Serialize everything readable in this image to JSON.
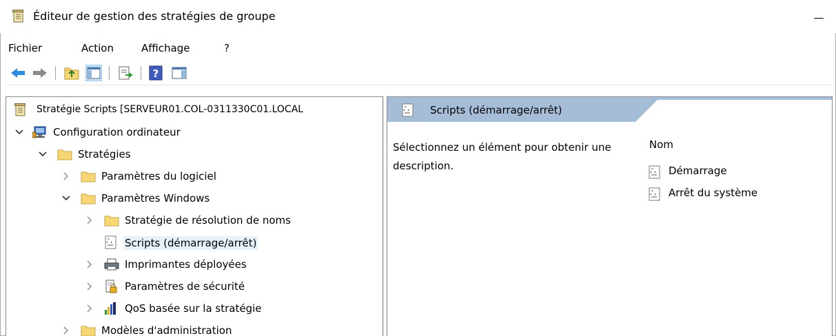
{
  "window": {
    "title": "Éditeur de gestion des stratégies de groupe"
  },
  "menu": [
    "Fichier",
    "Action",
    "Affichage",
    "?"
  ],
  "toolbar": {
    "icons": [
      "back-arrow-icon",
      "forward-arrow-icon",
      "up-folder-icon",
      "show-hide-tree-icon",
      "export-list-icon",
      "help-icon",
      "show-hide-action-pane-icon"
    ]
  },
  "tree": {
    "root": "Stratégie Scripts [SERVEUR01.COL-0311330C01.LOCAL",
    "computer_config": "Configuration ordinateur",
    "strategies": "Stratégies",
    "software_settings": "Paramètres du logiciel",
    "windows_settings": "Paramètres Windows",
    "name_resolution": "Stratégie de résolution de noms",
    "scripts": "Scripts (démarrage/arrêt)",
    "printers": "Imprimantes déployées",
    "security": "Paramètres de sécurité",
    "qos": "QoS basée sur la stratégie",
    "admin_templates": "Modèles d'administration"
  },
  "right_pane": {
    "header": "Scripts (démarrage/arrêt)",
    "description": "Sélectionnez un élément pour obtenir une description.",
    "column_name": "Nom",
    "items": [
      "Démarrage",
      "Arrêt du système"
    ]
  },
  "colors": {
    "header_blue": "#a6bdd8",
    "selection": "#e5f1fb",
    "folder": "#f7d774"
  }
}
